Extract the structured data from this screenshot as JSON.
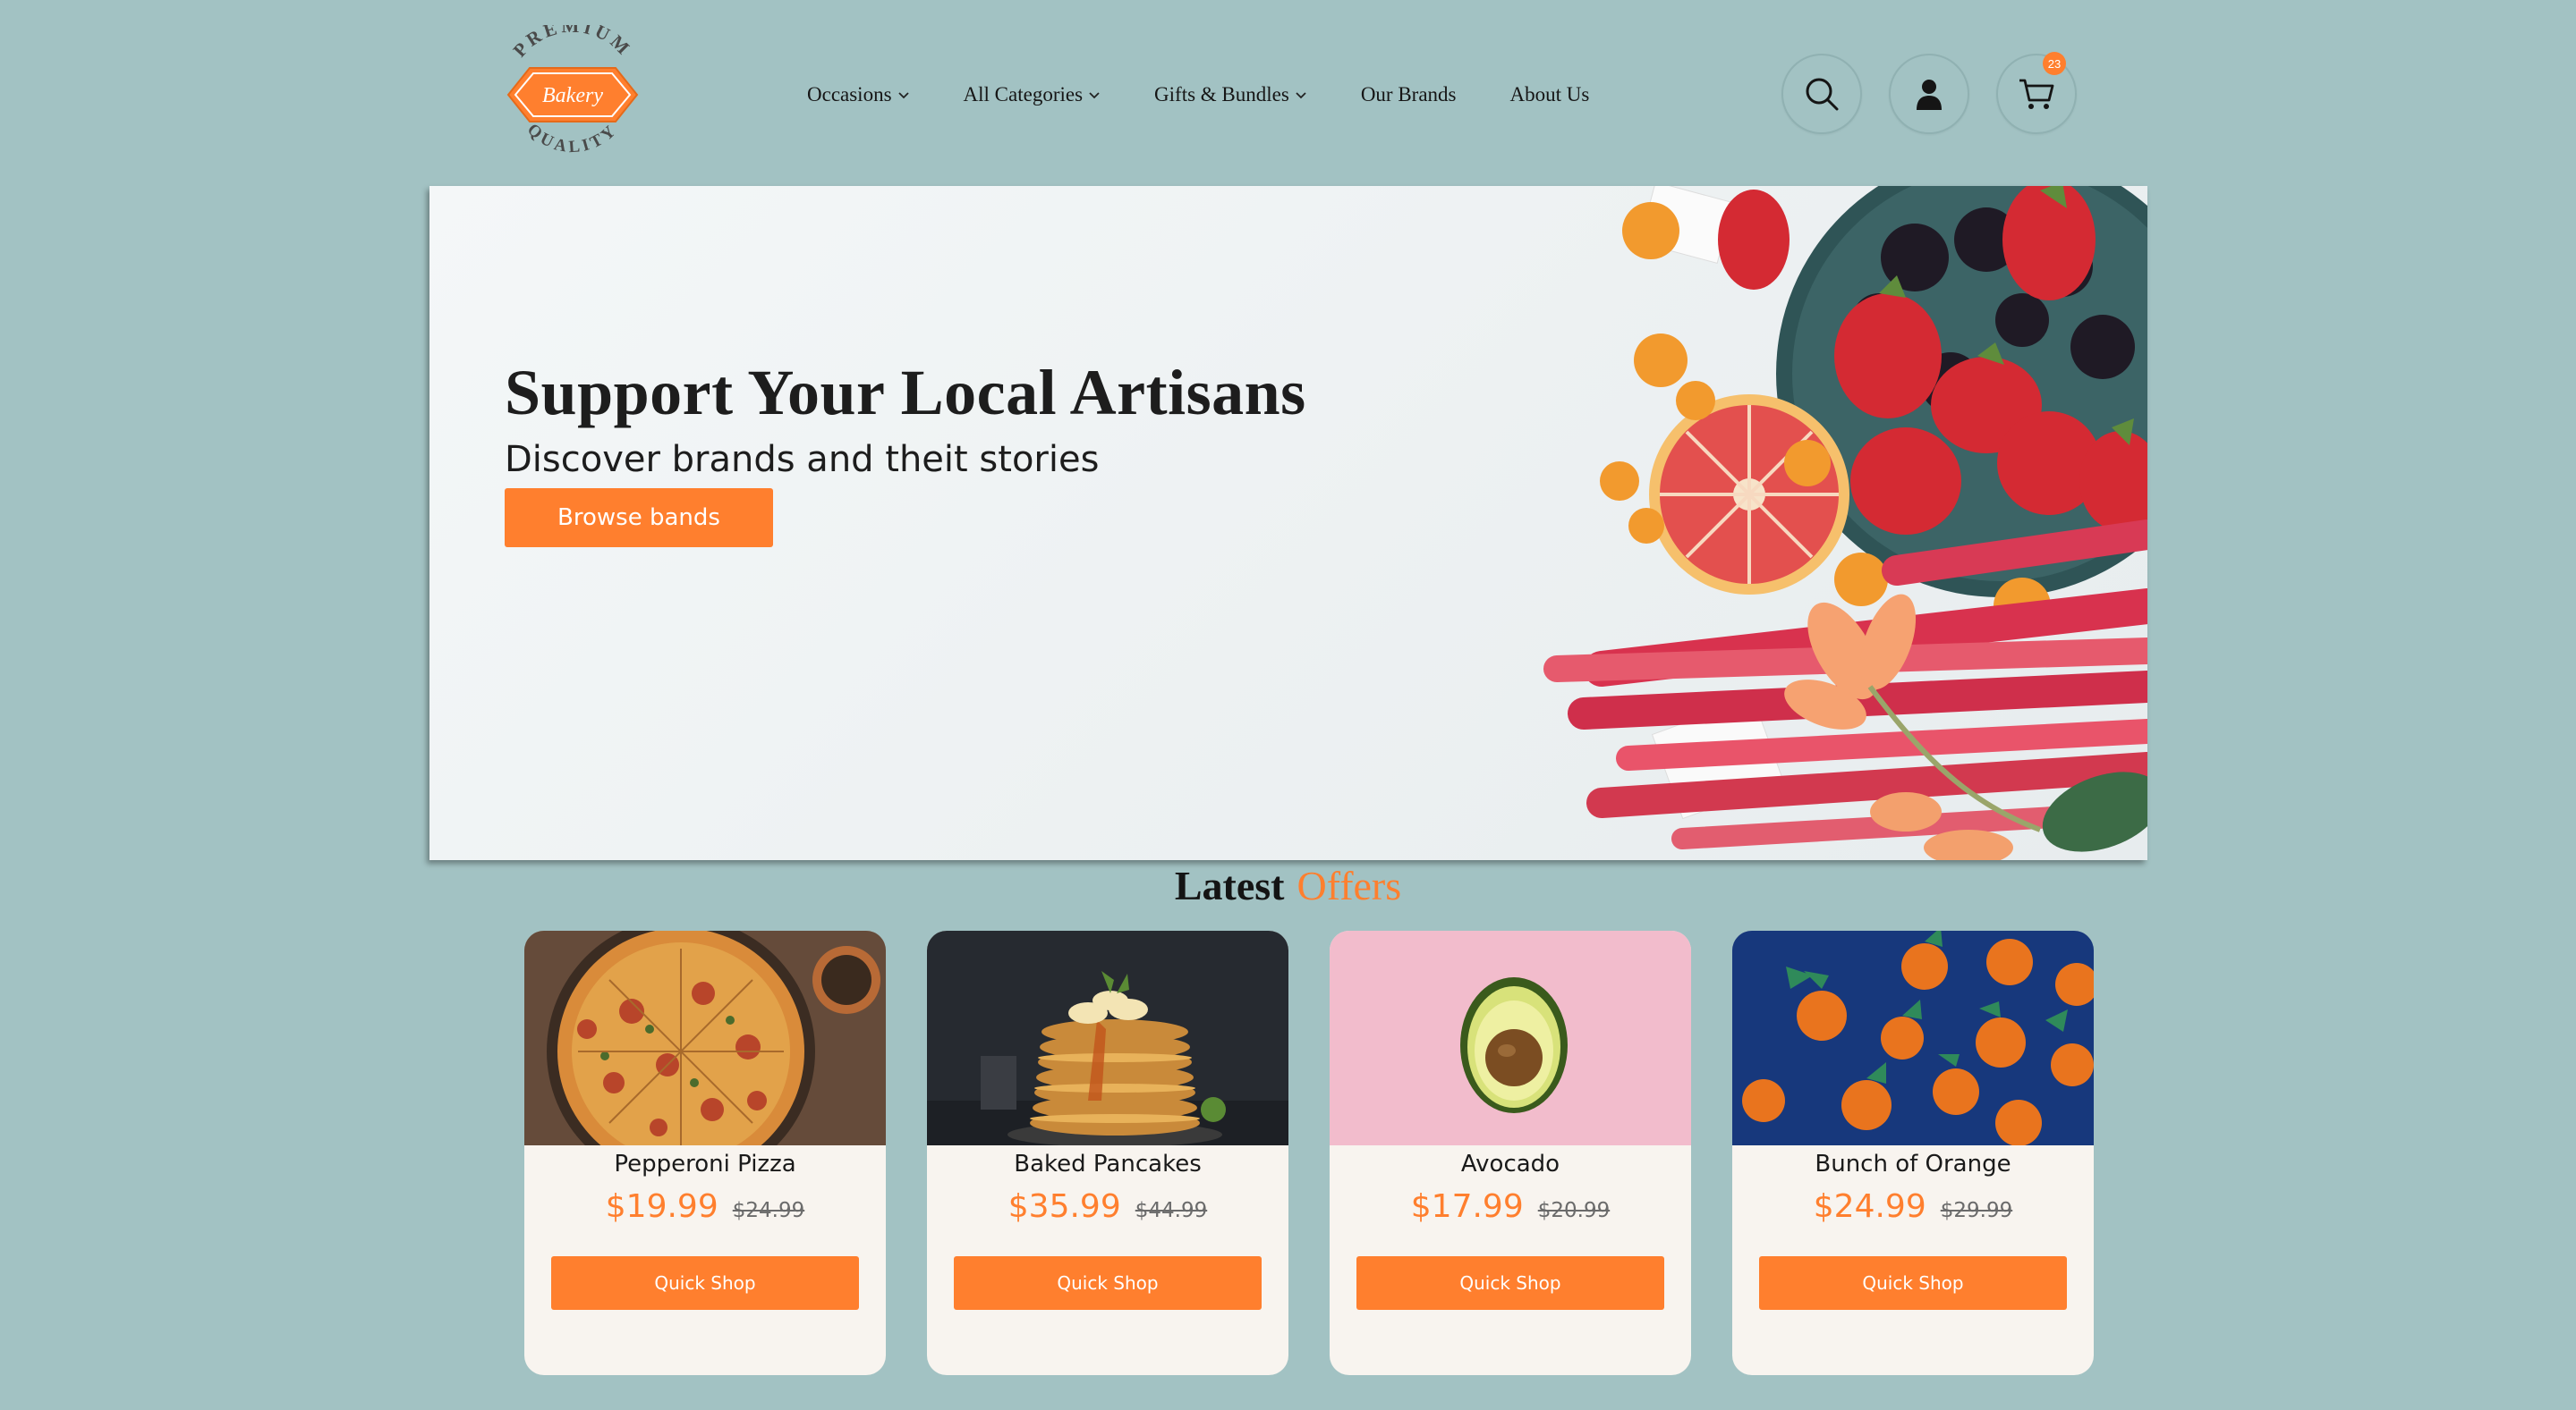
{
  "logo": {
    "top_text": "PREMIUM",
    "center_text": "Bakery",
    "bottom_text": "QUALITY",
    "accent": "#ff7f2e"
  },
  "nav": [
    {
      "label": "Occasions",
      "dropdown": true
    },
    {
      "label": "All Categories",
      "dropdown": true
    },
    {
      "label": "Gifts & Bundles",
      "dropdown": true
    },
    {
      "label": "Our Brands",
      "dropdown": false
    },
    {
      "label": "About Us",
      "dropdown": false
    }
  ],
  "header_icons": {
    "search": "search-icon",
    "account": "user-icon",
    "cart": "cart-icon",
    "cart_count": "23"
  },
  "hero": {
    "title": "Support Your Local Artisans",
    "subtitle": "Discover brands and theit stories",
    "button_label": "Browse bands"
  },
  "offers": {
    "title_part1": "Latest",
    "title_part2": "Offers"
  },
  "products": [
    {
      "name": "Pepperoni Pizza",
      "price": "$19.99",
      "old_price": "$24.99",
      "button": "Quick Shop",
      "image": "pizza"
    },
    {
      "name": "Baked Pancakes",
      "price": "$35.99",
      "old_price": "$44.99",
      "button": "Quick Shop",
      "image": "pancakes"
    },
    {
      "name": "Avocado",
      "price": "$17.99",
      "old_price": "$20.99",
      "button": "Quick Shop",
      "image": "avocado"
    },
    {
      "name": "Bunch of Orange",
      "price": "$24.99",
      "old_price": "$29.99",
      "button": "Quick Shop",
      "image": "oranges"
    }
  ],
  "colors": {
    "background": "#a2c2c3",
    "accent": "#ff7f2e",
    "card": "#f8f4ef"
  }
}
